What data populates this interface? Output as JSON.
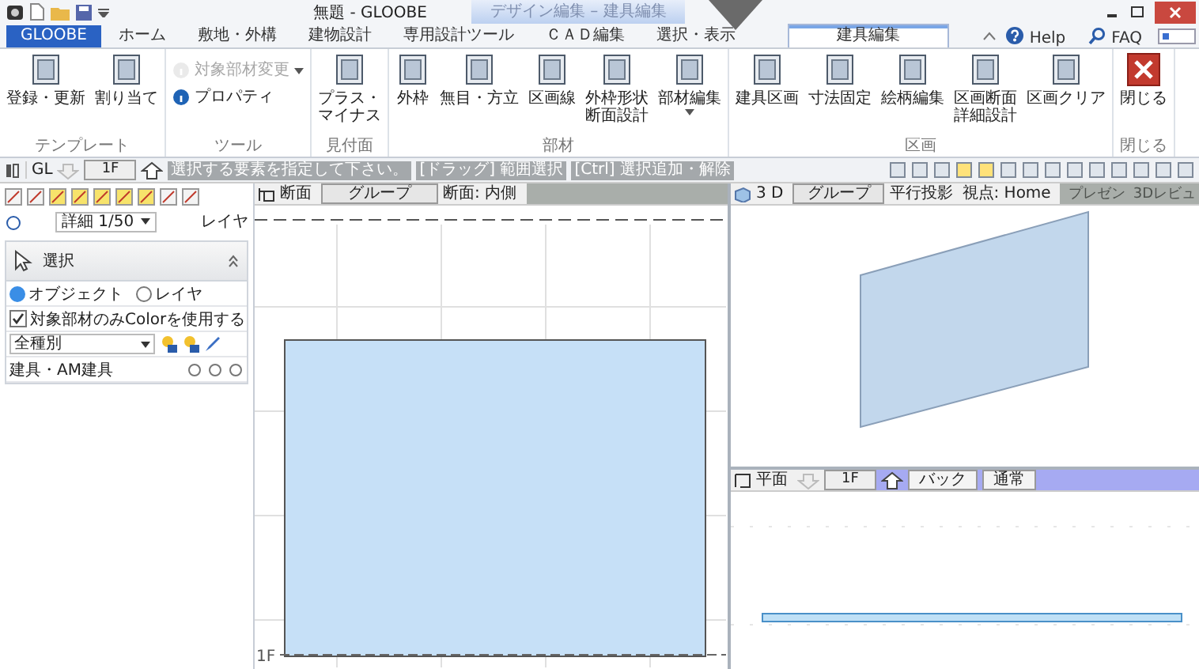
{
  "title_bar": {
    "title": "無題 - GLOOBE",
    "context_group": "デザイン編集 – 建具編集"
  },
  "tabs": [
    {
      "label": "GLOOBE",
      "kind": "app",
      "selected": false
    },
    {
      "label": "ホーム",
      "kind": "normal",
      "selected": false
    },
    {
      "label": "敷地・外構",
      "kind": "normal",
      "selected": false
    },
    {
      "label": "建物設計",
      "kind": "normal",
      "selected": false
    },
    {
      "label": "専用設計ツール",
      "kind": "normal",
      "selected": false
    },
    {
      "label": "ＣＡＤ編集",
      "kind": "normal",
      "selected": false
    },
    {
      "label": "選択・表示",
      "kind": "normal",
      "selected": false
    },
    {
      "label": "建具編集",
      "kind": "context",
      "selected": true
    }
  ],
  "help_links": [
    "Help",
    "FAQ"
  ],
  "ribbon": {
    "groups": [
      {
        "label": "テンプレート",
        "items": [
          {
            "label": "登録・更新",
            "kind": "large",
            "disabled": false,
            "dropdown": false
          },
          {
            "label": "割り当て",
            "kind": "large",
            "disabled": false,
            "dropdown": false
          }
        ]
      },
      {
        "label": "ツール",
        "items": [
          {
            "label": "対象部材変更",
            "kind": "small",
            "disabled": true,
            "dropdown": true
          },
          {
            "label": "プロパティ",
            "kind": "small",
            "disabled": false,
            "dropdown": false
          }
        ]
      },
      {
        "label": "見付面",
        "items": [
          {
            "label": "プラス・マイナス",
            "kind": "large",
            "disabled": false,
            "dropdown": false
          }
        ]
      },
      {
        "label": "部材",
        "items": [
          {
            "label": "外枠",
            "kind": "large",
            "disabled": false,
            "dropdown": false
          },
          {
            "label": "無目・方立",
            "kind": "large",
            "disabled": false,
            "dropdown": false
          },
          {
            "label": "区画線",
            "kind": "large",
            "disabled": false,
            "dropdown": false
          },
          {
            "label": "外枠形状断面設計",
            "kind": "large",
            "disabled": false,
            "dropdown": false
          },
          {
            "label": "部材編集",
            "kind": "large",
            "disabled": false,
            "dropdown": true
          }
        ]
      },
      {
        "label": "区画",
        "items": [
          {
            "label": "建具区画",
            "kind": "large",
            "disabled": false,
            "dropdown": false
          },
          {
            "label": "寸法固定",
            "kind": "large",
            "disabled": false,
            "dropdown": false
          },
          {
            "label": "絵柄編集",
            "kind": "large",
            "disabled": false,
            "dropdown": false
          },
          {
            "label": "区画断面詳細設計",
            "kind": "large",
            "disabled": false,
            "dropdown": false
          },
          {
            "label": "区画クリア",
            "kind": "large",
            "disabled": false,
            "dropdown": false
          }
        ]
      },
      {
        "label": "閉じる",
        "items": [
          {
            "label": "閉じる",
            "kind": "close",
            "disabled": false,
            "dropdown": false
          }
        ]
      }
    ]
  },
  "toolbar": {
    "level_label": "GL",
    "floor": "1F",
    "messages": [
      "選択する要素を指定して下さい。",
      "[ドラッグ] 範囲選択",
      "[Ctrl] 選択追加・解除"
    ]
  },
  "left_panel": {
    "scale": "詳細 1/50",
    "layer_button": "レイヤ",
    "tool_panel": {
      "title": "選択",
      "modes": [
        {
          "label": "オブジェクト",
          "selected": true
        },
        {
          "label": "レイヤ",
          "selected": false
        }
      ],
      "color_option": {
        "label": "対象部材のみColorを使用する",
        "checked": true
      },
      "filter": "全種別",
      "rows": [
        {
          "label": "建具・AM建具"
        }
      ]
    }
  },
  "section_view": {
    "title": "断面",
    "group_button": "グループ",
    "direction": "断面: 内側",
    "floor_label": "1F"
  },
  "view_3d": {
    "title": "3 D",
    "group_button": "グループ",
    "projection": "平行投影",
    "viewpoint": "視点: Home",
    "buttons": [
      "プレゼン",
      "3Dレビュ"
    ]
  },
  "plan_view": {
    "title": "平面",
    "floor": "1F",
    "back_button": "バック",
    "mode_button": "通常"
  }
}
